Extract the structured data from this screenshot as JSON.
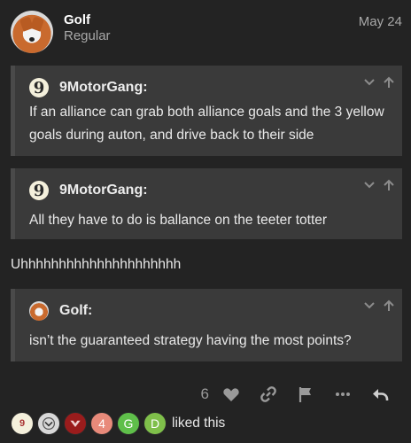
{
  "post": {
    "author": "Golf",
    "user_title": "Regular",
    "date": "May 24"
  },
  "quotes": [
    {
      "author": "9MotorGang:",
      "avatar_letter": "9",
      "text": "If an alliance can grab both alliance goals and the 3 yellow goals during auton, and drive back to their side"
    },
    {
      "author": "9MotorGang:",
      "avatar_letter": "9",
      "text": "All they have to do is ballance on the teeter totter"
    },
    {
      "author": "Golf:",
      "text": "isn’t the guaranteed strategy having the most points?"
    }
  ],
  "body_text": "Uhhhhhhhhhhhhhhhhhhhhh",
  "actions": {
    "like_count": "6",
    "icons": [
      "heart-icon",
      "link-icon",
      "flag-icon",
      "more-icon",
      "reply-icon"
    ]
  },
  "likers": {
    "avatars": [
      "9",
      "",
      "",
      "4",
      "G",
      "D"
    ],
    "suffix": "liked this"
  },
  "colors": {
    "background": "#232323",
    "quote_background": "#3a3a3a",
    "muted": "#a8a8a8"
  }
}
